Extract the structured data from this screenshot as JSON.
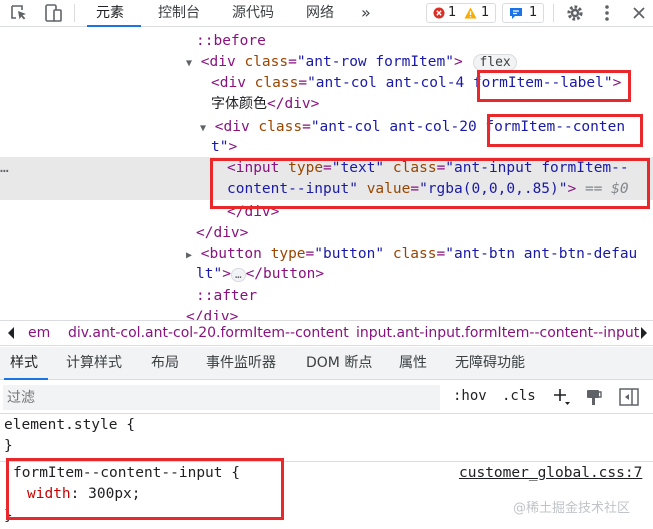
{
  "toolbar": {
    "tabs": [
      "元素",
      "控制台",
      "源代码",
      "网络"
    ],
    "more": "»",
    "errors": "1",
    "warnings": "1",
    "messages": "1"
  },
  "tree": {
    "before": "::before",
    "row_open_tag": "div",
    "row_class_attr": "class",
    "row_class_val": "\"ant-row formItem\"",
    "flex_badge": "flex",
    "col4_tag": "div",
    "col4_class_val": "\"ant-col ant-col-4 formItem--label\"",
    "label_text": "字体颜色",
    "col20_class_val_1": "\"ant-col ant-col-20 formItem--conten",
    "col20_class_val_2": "t\"",
    "input_tag": "input",
    "input_type_attr": "type",
    "input_type_val": "\"text\"",
    "input_class_attr": "class",
    "input_class_val_1": "\"ant-input formItem--",
    "input_class_val_2": "content--input\"",
    "input_value_attr": "value",
    "input_value_val": "\"rgba(0,0,0,.85)\"",
    "selected_marker": "== $0",
    "close_div": "</div>",
    "button_type_val": "\"button\"",
    "button_class_val_1": "\"ant-btn ant-btn-defau",
    "button_class_val_2": "lt\"",
    "ellipsis": "…",
    "close_button": "</button>",
    "after": "::after",
    "gutter_dots": "…"
  },
  "breadcrumbs": [
    "em",
    "div.ant-col.ant-col-20.formItem--content",
    "input.ant-input.formItem--content--input"
  ],
  "subtabs": [
    "样式",
    "计算样式",
    "布局",
    "事件监听器",
    "DOM 断点",
    "属性",
    "无障碍功能"
  ],
  "filter": {
    "placeholder": "过滤",
    "hov": ":hov",
    "cls": ".cls"
  },
  "rules": {
    "element_style_selector": "element.style {",
    "element_style_close": "}",
    "rule_selector": "formItem--content--input {",
    "rule_source": "customer_global.css:7",
    "rule_property": "width",
    "rule_value": "300px;",
    "rule_close": "}"
  },
  "watermark": "@稀土掘金技术社区"
}
